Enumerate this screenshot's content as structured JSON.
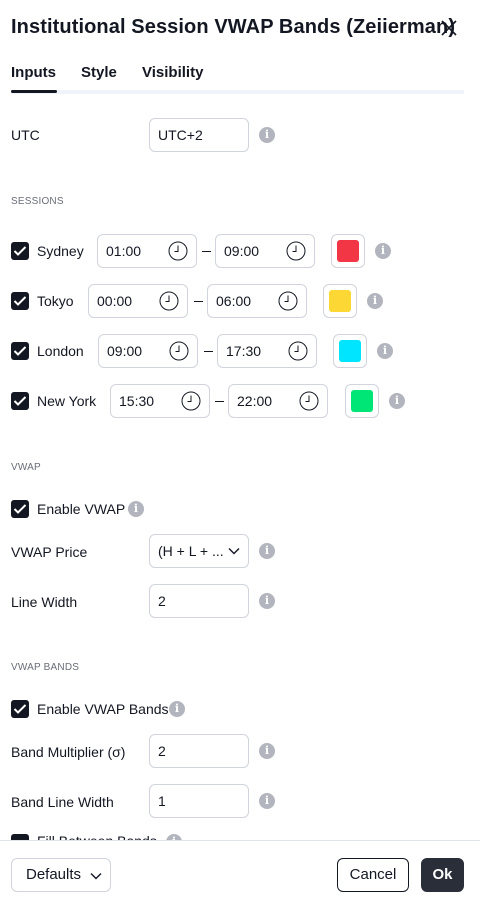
{
  "dialog": {
    "title": "Institutional Session VWAP Bands (Zeiierman)"
  },
  "tabs": [
    {
      "label": "Inputs",
      "active": true
    },
    {
      "label": "Style",
      "active": false
    },
    {
      "label": "Visibility",
      "active": false
    }
  ],
  "utc": {
    "label": "UTC",
    "value": "UTC+2"
  },
  "sessions": {
    "section_label": "SESSIONS",
    "items": [
      {
        "name": "Sydney",
        "checked": true,
        "start": "01:00",
        "end": "09:00",
        "color": "#f23645"
      },
      {
        "name": "Tokyo",
        "checked": true,
        "start": "00:00",
        "end": "06:00",
        "color": "#fdd835"
      },
      {
        "name": "London",
        "checked": true,
        "start": "09:00",
        "end": "17:30",
        "color": "#00e5ff"
      },
      {
        "name": "New York",
        "checked": true,
        "start": "15:30",
        "end": "22:00",
        "color": "#00e676"
      }
    ]
  },
  "vwap": {
    "section_label": "VWAP",
    "enable_label": "Enable VWAP",
    "enable_checked": true,
    "price_label": "VWAP Price",
    "price_value": "(H + L + ...",
    "width_label": "Line Width",
    "width_value": "2"
  },
  "bands": {
    "section_label": "VWAP BANDS",
    "enable_label": "Enable VWAP Bands",
    "enable_checked": true,
    "mult_label": "Band Multiplier (σ)",
    "mult_value": "2",
    "width_label": "Band Line Width",
    "width_value": "1",
    "fill_label": "Fill Between Bands"
  },
  "footer": {
    "defaults_label": "Defaults",
    "cancel_label": "Cancel",
    "ok_label": "Ok"
  },
  "icons": {
    "close": "close-icon",
    "info": "info-icon",
    "clock": "clock-icon",
    "checkbox": "checkmark-icon",
    "chevron": "chevron-down-icon"
  }
}
